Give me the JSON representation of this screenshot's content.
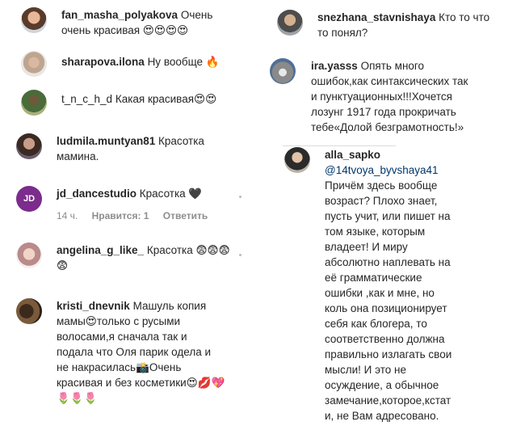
{
  "left": {
    "comments": [
      {
        "user": "fan_masha_polyakova",
        "text_l1": "Очень",
        "text_l2": "очень красивая 😍😍😍😍"
      },
      {
        "user": "sharapova.ilona",
        "text": "Ну вообще 🔥"
      },
      {
        "user": "t_n_c_h_d",
        "text": "Какая красивая😍😍"
      },
      {
        "user": "ludmila.muntyan81",
        "text_l1": "Красотка",
        "text_l2": "мамина."
      },
      {
        "user": "jd_dancestudio",
        "text": "Красотка 🖤",
        "avatar_label": "JD",
        "meta": {
          "time": "14 ч.",
          "likes": "Нравится: 1",
          "reply": "Ответить"
        }
      },
      {
        "user": "angelina_g_like_",
        "text_l1": "Красотка 😨😨😨",
        "text_l2": "😨"
      },
      {
        "user": "kristi_dnevnik",
        "lines": [
          "Машуль копия",
          "мамы😍только с русыми",
          "волосами,я сначала так и",
          "подала что Оля парик одела и",
          "не накрасилась📸Очень",
          "красивая и без косметики😍💋💖",
          "🌷🌷🌷"
        ]
      }
    ]
  },
  "right": {
    "comments": [
      {
        "user": "snezhana_stavnishaya",
        "text_l1": "Кто то что",
        "text_l2": "то понял?"
      },
      {
        "user": "ira.yasss",
        "lines_user": "Опять много",
        "lines": [
          "ошибок,как синтаксических так",
          "и пунктуационных!!!Хочется",
          "лозунг 1917 года прокричать",
          "тебе«Долой безграмотность!»"
        ]
      },
      {
        "user": "alla_sapko",
        "mention": "@14tvoya_byvshaya41",
        "lines": [
          "Причём здесь вообще",
          "возраст? Плохо знает,",
          "пусть учит, или пишет на",
          "том языке, которым",
          "владеет! И миру",
          "абсолютно наплевать на",
          "её грамматические",
          "ошибки ,как и мне, но",
          "коль она позиционирует",
          "себя как блогера, то",
          "соответственно должна",
          "правильно излагать свои",
          "мысли! И это не",
          "осуждение, а обычное",
          "замечание,которое,кстат",
          "и, не Вам адресовано."
        ]
      }
    ]
  },
  "icons": {
    "more": "more-dots-icon"
  }
}
